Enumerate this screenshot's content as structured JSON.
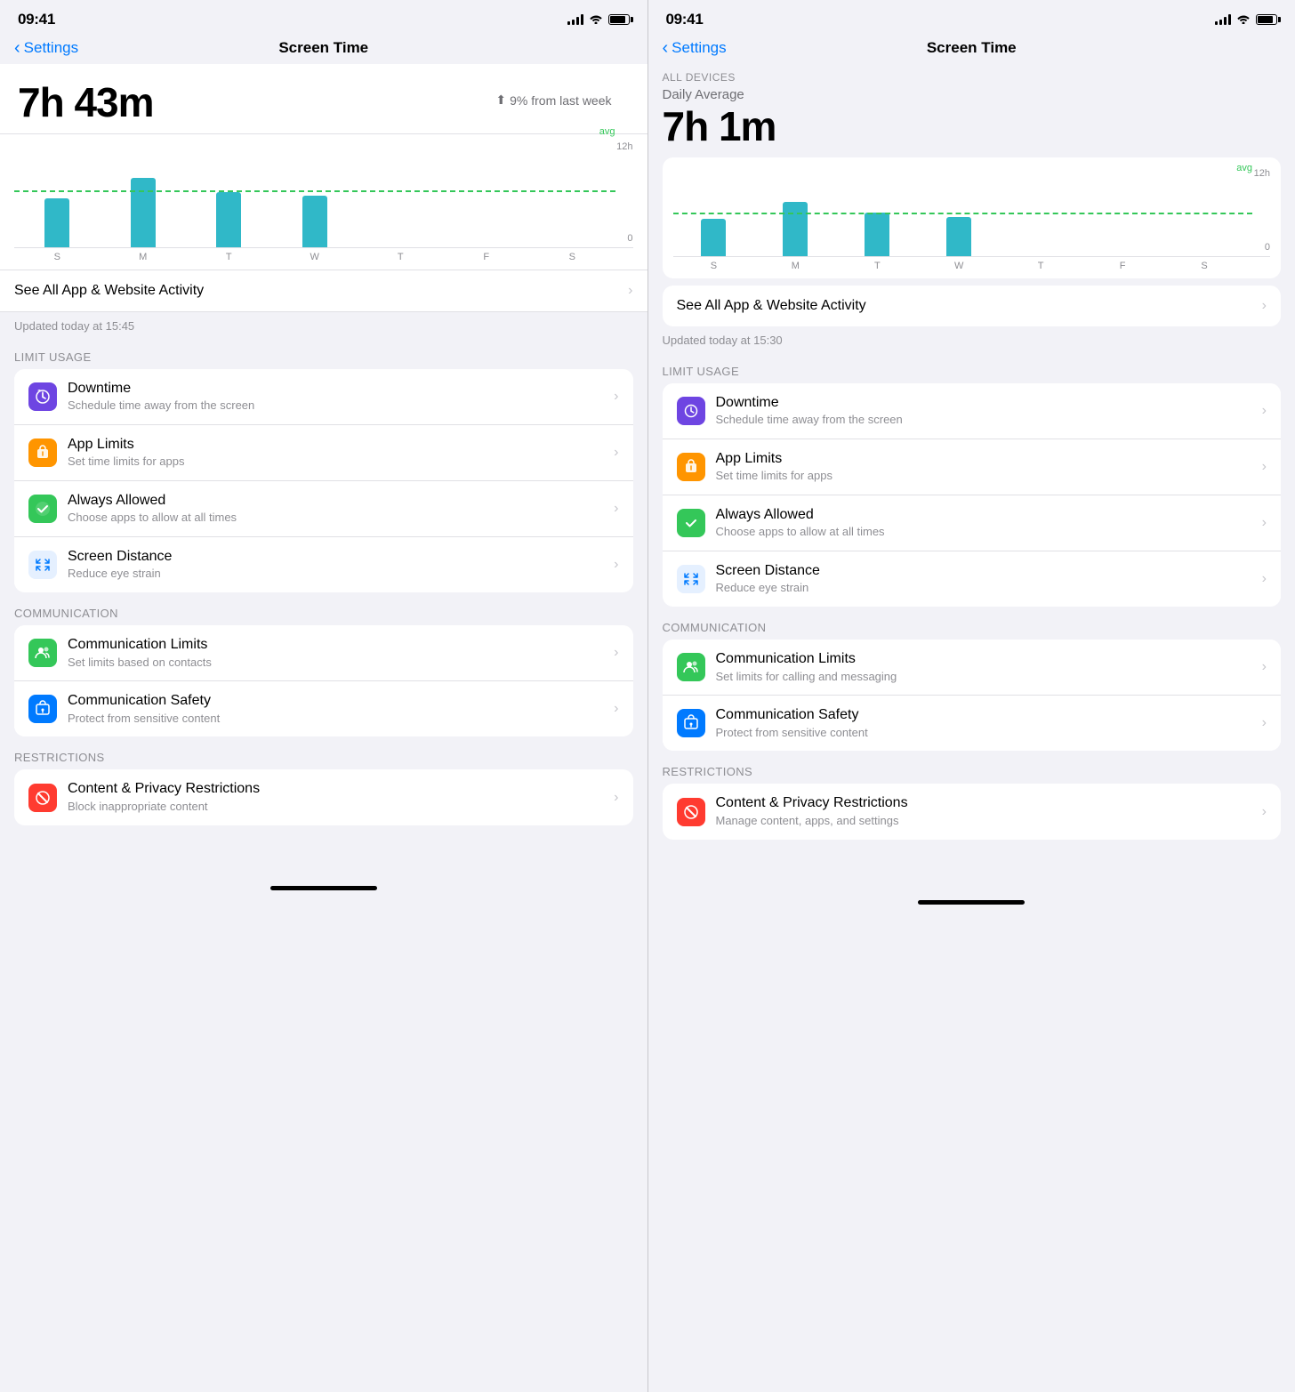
{
  "left": {
    "statusBar": {
      "time": "09:41"
    },
    "nav": {
      "back": "Settings",
      "title": "Screen Time"
    },
    "usage": {
      "time": "7h 43m",
      "change": "9% from last week",
      "changeArrow": "↑"
    },
    "chart": {
      "yLabels": {
        "top": "12h",
        "bottom": "0"
      },
      "avgLabel": "avg",
      "xLabels": [
        "S",
        "M",
        "T",
        "W",
        "T",
        "F",
        "S"
      ],
      "bars": [
        55,
        78,
        62,
        58,
        0,
        0,
        0
      ],
      "avgPercent": 62
    },
    "seeAll": "See All App & Website Activity",
    "updated": "Updated today at 15:45",
    "limitUsage": {
      "header": "LIMIT USAGE",
      "items": [
        {
          "icon": "downtime",
          "iconColor": "purple",
          "title": "Downtime",
          "subtitle": "Schedule time away from the screen"
        },
        {
          "icon": "applimits",
          "iconColor": "orange",
          "title": "App Limits",
          "subtitle": "Set time limits for apps"
        },
        {
          "icon": "alwaysallowed",
          "iconColor": "green",
          "title": "Always Allowed",
          "subtitle": "Choose apps to allow at all times"
        },
        {
          "icon": "screendistance",
          "iconColor": "screenDistanceBlue",
          "title": "Screen Distance",
          "subtitle": "Reduce eye strain"
        }
      ]
    },
    "communication": {
      "header": "COMMUNICATION",
      "items": [
        {
          "icon": "commlimits",
          "iconColor": "green",
          "title": "Communication Limits",
          "subtitle": "Set limits based on contacts"
        },
        {
          "icon": "commsafety",
          "iconColor": "blue",
          "title": "Communication Safety",
          "subtitle": "Protect from sensitive content"
        }
      ]
    },
    "restrictions": {
      "header": "RESTRICTIONS",
      "items": [
        {
          "icon": "contentprivacy",
          "iconColor": "red",
          "title": "Content & Privacy Restrictions",
          "subtitle": "Block inappropriate content"
        }
      ]
    }
  },
  "right": {
    "statusBar": {
      "time": "09:41"
    },
    "nav": {
      "back": "Settings",
      "title": "Screen Time"
    },
    "allDevices": "ALL DEVICES",
    "dailyAverage": "Daily Average",
    "usage": {
      "time": "7h 1m"
    },
    "chart": {
      "yLabels": {
        "top": "12h",
        "bottom": "0"
      },
      "avgLabel": "avg",
      "xLabels": [
        "S",
        "M",
        "T",
        "W",
        "T",
        "F",
        "S"
      ],
      "bars": [
        50,
        72,
        58,
        52,
        0,
        0,
        0
      ],
      "avgPercent": 55
    },
    "seeAll": "See All App & Website Activity",
    "updated": "Updated today at 15:30",
    "limitUsage": {
      "header": "LIMIT USAGE",
      "items": [
        {
          "icon": "downtime",
          "iconColor": "purple",
          "title": "Downtime",
          "subtitle": "Schedule time away from the screen"
        },
        {
          "icon": "applimits",
          "iconColor": "orange",
          "title": "App Limits",
          "subtitle": "Set time limits for apps"
        },
        {
          "icon": "alwaysallowed",
          "iconColor": "green",
          "title": "Always Allowed",
          "subtitle": "Choose apps to allow at all times"
        },
        {
          "icon": "screendistance",
          "iconColor": "screenDistanceBlue",
          "title": "Screen Distance",
          "subtitle": "Reduce eye strain"
        }
      ]
    },
    "communication": {
      "header": "COMMUNICATION",
      "items": [
        {
          "icon": "commlimits",
          "iconColor": "green",
          "title": "Communication Limits",
          "subtitle": "Set limits for calling and messaging"
        },
        {
          "icon": "commsafety",
          "iconColor": "blue",
          "title": "Communication Safety",
          "subtitle": "Protect from sensitive content"
        }
      ]
    },
    "restrictions": {
      "header": "RESTRICTIONS",
      "items": [
        {
          "icon": "contentprivacy",
          "iconColor": "red",
          "title": "Content & Privacy Restrictions",
          "subtitle": "Manage content, apps, and settings"
        }
      ]
    }
  }
}
